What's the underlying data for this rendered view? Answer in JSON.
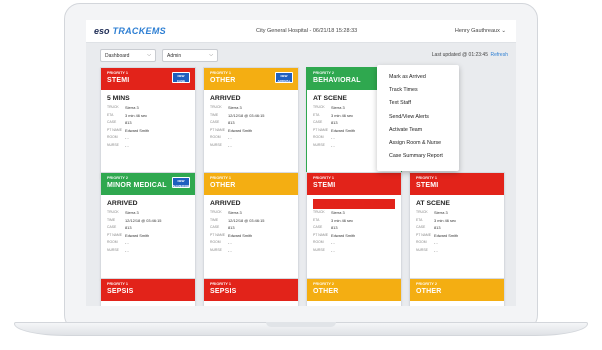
{
  "app": {
    "logo_eso": "eso",
    "logo_name": "TRACKEMS",
    "center_title": "City General Hospital - 06/21/18 15:28:33",
    "user": "Henry Gauthreaux ⌄"
  },
  "toolbar": {
    "dashboard_select": "Dashboard",
    "admin_select": "Admin",
    "updated": "Last updated @ 01:23:45",
    "refresh": "Refresh"
  },
  "colors": {
    "red": "#e2231a",
    "orange": "#f4ae12",
    "green": "#2fa84f",
    "badge_blue": "#1e5fbf",
    "accent": "#2e7fd3"
  },
  "field_labels": {
    "truck": "TRUCK",
    "eta": "ETA",
    "time": "TIME",
    "case": "CASE",
    "pt_name": "PT NAME",
    "room": "ROOM",
    "nurse": "NURSE"
  },
  "cards": [
    {
      "priority": "PRIORITY 1",
      "label": "STEMI",
      "color": "red",
      "badge": "NEW CASE",
      "status": "5 MINS",
      "k2": "ETA",
      "truck": "Sierra 3",
      "v2": "3 min 46 sec",
      "case": "813",
      "pt": "Edward Smith",
      "room": "- -",
      "nurse": "- -"
    },
    {
      "priority": "PRIORITY 1",
      "label": "OTHER",
      "color": "orange",
      "badge": "NEW ARRIVAL",
      "status": "ARRIVED",
      "k2": "TIME",
      "truck": "Sierra 3",
      "v2": "12/12/18 @ 03:46:15",
      "case": "813",
      "pt": "Edward Smith",
      "room": "- -",
      "nurse": "- -"
    },
    {
      "priority": "PRIORITY 2",
      "label": "BEHAVIORAL",
      "color": "green",
      "badge": "",
      "status": "AT SCENE",
      "k2": "ETA",
      "truck": "Sierra 3",
      "v2": "3 min 46 sec",
      "case": "813",
      "pt": "Edward Smith",
      "room": "- -",
      "nurse": "- -"
    },
    {
      "priority": "PRIORITY 2",
      "label": "MINOR MEDICAL",
      "color": "green",
      "badge": "NEW NAME/DOB",
      "status": "ARRIVED",
      "k2": "TIME",
      "truck": "Sierra 3",
      "v2": "12/12/18 @ 03:46:15",
      "case": "813",
      "pt": "Edward Smith",
      "room": "- -",
      "nurse": "- -"
    },
    {
      "priority": "PRIORITY 1",
      "label": "OTHER",
      "color": "orange",
      "badge": "",
      "status": "ARRIVED",
      "k2": "TIME",
      "truck": "Sierra 3",
      "v2": "12/12/18 @ 03:46:15",
      "case": "813",
      "pt": "Edward Smith",
      "room": "- -",
      "nurse": "- -"
    },
    {
      "priority": "PRIORITY 1",
      "label": "STEMI",
      "color": "red",
      "badge": "",
      "status": "D2B 99999 MIN 59 SEC",
      "k2": "ETA",
      "truck": "Sierra 3",
      "v2": "3 min 46 sec",
      "case": "813",
      "pt": "Edward Smith",
      "room": "- -",
      "nurse": "- -"
    },
    {
      "priority": "PRIORITY 1",
      "label": "STEMI",
      "color": "red",
      "badge": "",
      "status": "AT SCENE",
      "k2": "ETA",
      "truck": "Sierra 3",
      "v2": "3 min 46 sec",
      "case": "813",
      "pt": "Edward Smith",
      "room": "- -",
      "nurse": "- -"
    },
    {
      "priority": "PRIORITY 1",
      "label": "SEPSIS",
      "color": "red"
    },
    {
      "priority": "PRIORITY 1",
      "label": "SEPSIS",
      "color": "red"
    },
    {
      "priority": "PRIORITY 2",
      "label": "OTHER",
      "color": "orange"
    },
    {
      "priority": "PRIORITY 2",
      "label": "OTHER",
      "color": "orange"
    }
  ],
  "context_menu": [
    "Mark as Arrived",
    "Track Times",
    "Text Staff",
    "Send/View Alerts",
    "Activate Team",
    "Assign Room & Nurse",
    "Case Summary Report"
  ]
}
